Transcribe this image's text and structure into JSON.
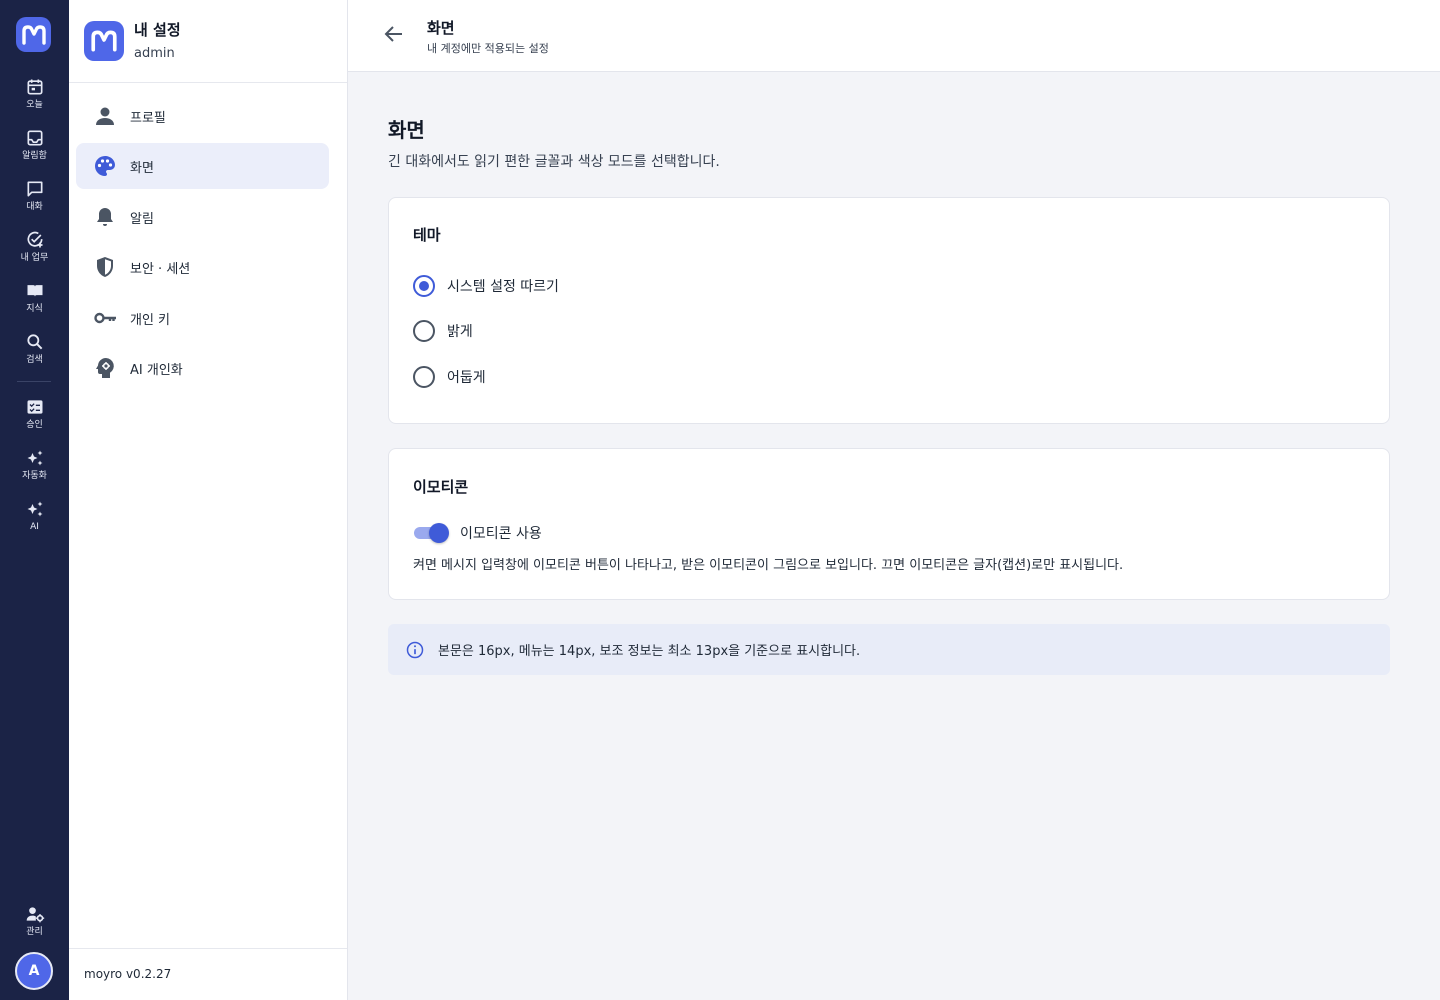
{
  "rail": {
    "items": [
      {
        "label": "오늘",
        "icon": "calendar-icon"
      },
      {
        "label": "알림함",
        "icon": "inbox-icon"
      },
      {
        "label": "대화",
        "icon": "chat-icon"
      },
      {
        "label": "내 업무",
        "icon": "task-check-icon"
      },
      {
        "label": "지식",
        "icon": "book-icon"
      },
      {
        "label": "검색",
        "icon": "search-icon"
      },
      {
        "label": "승인",
        "icon": "approval-icon"
      },
      {
        "label": "자동화",
        "icon": "sparkle-icon"
      },
      {
        "label": "AI",
        "icon": "sparkle-icon"
      },
      {
        "label": "관리",
        "icon": "admin-gear-icon"
      }
    ],
    "avatar_initial": "A"
  },
  "sidebar": {
    "title": "내 설정",
    "subtitle": "admin",
    "items": [
      {
        "label": "프로필",
        "icon": "person-icon"
      },
      {
        "label": "화면",
        "icon": "palette-icon",
        "active": true
      },
      {
        "label": "알림",
        "icon": "bell-icon"
      },
      {
        "label": "보안 · 세션",
        "icon": "shield-icon"
      },
      {
        "label": "개인 키",
        "icon": "key-icon"
      },
      {
        "label": "AI 개인화",
        "icon": "ai-head-icon"
      }
    ],
    "version": "moyro v0.2.27"
  },
  "topbar": {
    "title": "화면",
    "subtitle": "내 계정에만 적용되는 설정"
  },
  "main": {
    "heading": "화면",
    "description": "긴 대화에서도 읽기 편한 글꼴과 색상 모드를 선택합니다.",
    "theme": {
      "title": "테마",
      "options": [
        {
          "label": "시스템 설정 따르기",
          "selected": true
        },
        {
          "label": "밝게",
          "selected": false
        },
        {
          "label": "어둡게",
          "selected": false
        }
      ]
    },
    "emoticon": {
      "title": "이모티콘",
      "toggle_label": "이모티콘 사용",
      "enabled": true,
      "help": "켜면 메시지 입력창에 이모티콘 버튼이 나타나고, 받은 이모티콘이 그림으로 보입니다. 끄면 이모티콘은 글자(캡션)로만 표시됩니다."
    },
    "info": "본문은 16px, 메뉴는 14px, 보조 정보는 최소 13px을 기준으로 표시합니다."
  },
  "colors": {
    "rail_bg": "#1b2346",
    "accent": "#4f67e8",
    "active_bg": "#ebeefa",
    "page_bg": "#f3f4f8"
  }
}
